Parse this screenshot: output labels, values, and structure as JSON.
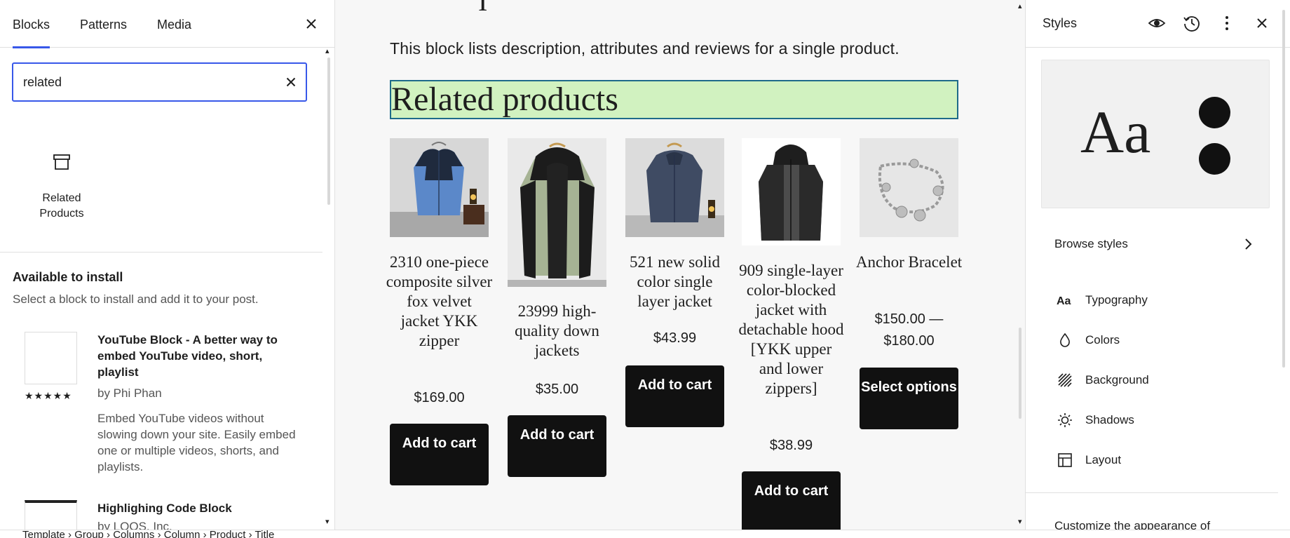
{
  "inserter": {
    "tabs": [
      {
        "label": "Blocks",
        "active": true
      },
      {
        "label": "Patterns",
        "active": false
      },
      {
        "label": "Media",
        "active": false
      }
    ],
    "search_value": "related",
    "result_block": {
      "label": "Related Products",
      "icon": "archive-box-icon"
    },
    "section_title": "Available to install",
    "section_desc": "Select a block to install and add it to your post.",
    "plugins": [
      {
        "name": "YouTube Block - A better way to embed YouTube video, short, playlist",
        "author": "by Phi Phan",
        "rating": "★★★★★",
        "desc": "Embed YouTube videos without slowing down your site. Easily embed one or multiple videos, shorts, and playlists."
      },
      {
        "name": "Highlighing Code Block",
        "author": "by LOOS, Inc.",
        "rating": "",
        "desc": ""
      }
    ]
  },
  "canvas": {
    "cut_glyph": "I",
    "block_description": "This block lists description, attributes and reviews for a single product.",
    "heading": "Related products",
    "products": [
      {
        "title": "2310 one-piece composite silver fox velvet jacket YKK zipper",
        "price": "$169.00",
        "button": "Add to cart",
        "image": "blue-black-jacket"
      },
      {
        "title": "23999 high-quality down jackets",
        "price": "$35.00",
        "button": "Add to cart",
        "image": "green-black-hooded-jacket"
      },
      {
        "title": "521 new solid color single layer jacket",
        "price": "$43.99",
        "button": "Add to cart",
        "image": "navy-jacket"
      },
      {
        "title": "909 single-layer color-blocked jacket with detachable hood [YKK upper and lower zippers]",
        "price": "$38.99",
        "button": "Add to cart",
        "image": "gray-black-hooded-jacket"
      },
      {
        "title": "Anchor Bracelet",
        "price": "$150.00 — $180.00",
        "button": "Select options",
        "image": "silver-charm-bracelet"
      }
    ]
  },
  "styles": {
    "title": "Styles",
    "preview_text": "Aa",
    "browse_label": "Browse styles",
    "nav": [
      {
        "label": "Typography",
        "icon": "typography-icon"
      },
      {
        "label": "Colors",
        "icon": "droplet-icon"
      },
      {
        "label": "Background",
        "icon": "background-pattern-icon"
      },
      {
        "label": "Shadows",
        "icon": "shadow-sun-icon"
      },
      {
        "label": "Layout",
        "icon": "layout-icon"
      }
    ],
    "customize_text": "Customize the appearance of"
  },
  "footer": {
    "breadcrumb": "Template  ›  Group  ›  Columns  ›  Column  ›  Product  ›  Title"
  },
  "colors": {
    "accent": "#3858e9",
    "heading_highlight": "#d1f2c0",
    "button_bg": "#111111"
  }
}
